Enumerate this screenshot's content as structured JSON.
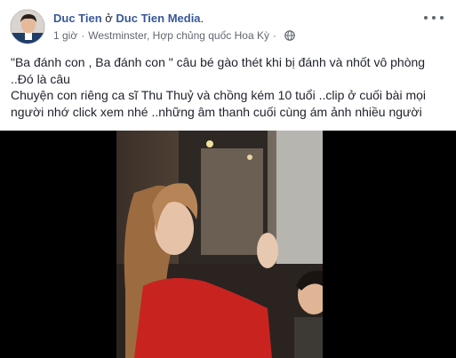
{
  "post": {
    "author_name": "Duc Tien",
    "author_separator": " ở ",
    "page_name": "Duc Tien Media",
    "page_suffix": ".",
    "time_ago": "1 giờ",
    "separator": "·",
    "location": "Westminster, Hợp chủng quốc Hoa Kỳ",
    "privacy_icon": "globe-icon",
    "more_icon": "more-options-icon",
    "text_lines": [
      "\"Ba đánh con , Ba đánh con \" câu bé gào thét khi bị đánh và nhốt vô phòng",
      "..Đó là câu",
      "Chuyện con riêng ca sĩ Thu Thuỷ và chồng kém 10 tuổi ..clip ở cuối bài mọi",
      "người nhớ click xem nhé ..những âm thanh cuối cùng ám ảnh nhiều người"
    ]
  },
  "video": {
    "background_color": "#000000"
  },
  "colors": {
    "link": "#385898",
    "text": "#1d2129",
    "meta": "#616770"
  }
}
